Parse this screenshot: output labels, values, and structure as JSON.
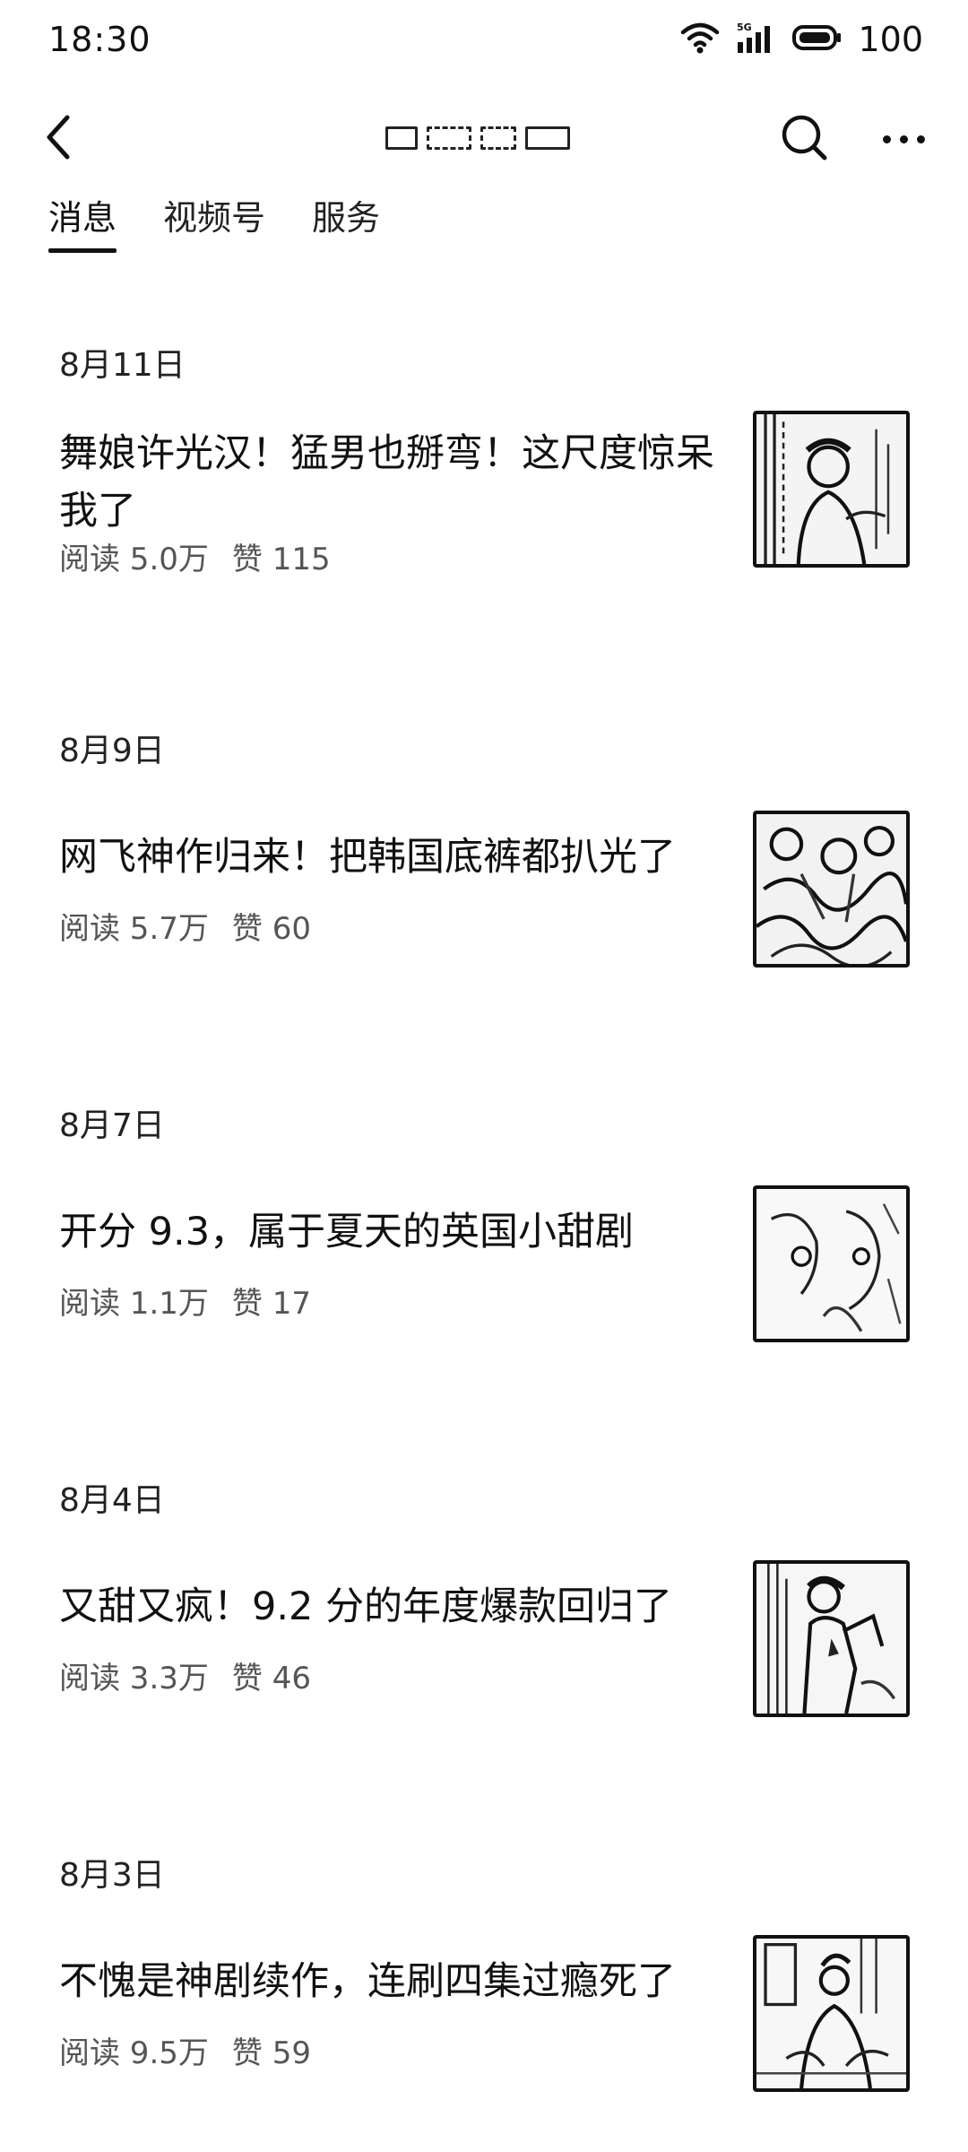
{
  "status_bar": {
    "time": "18:30",
    "network": "5G",
    "battery": "100",
    "icons": [
      "wifi-icon",
      "signal-5g-icon",
      "battery-icon"
    ]
  },
  "header": {
    "back_icon": "chevron-left-icon",
    "search_icon": "search-icon",
    "more_icon": "more-dots-icon"
  },
  "tabs": [
    {
      "label": "消息",
      "active": true
    },
    {
      "label": "视频号",
      "active": false
    },
    {
      "label": "服务",
      "active": false
    }
  ],
  "articles": [
    {
      "date": "8月11日",
      "title": "舞娘许光汉！猛男也掰弯！这尺度惊呆我了",
      "reads": "阅读 5.0万",
      "likes": "赞 115"
    },
    {
      "date": "8月9日",
      "title": "网飞神作归来！把韩国底裤都扒光了",
      "reads": "阅读 5.7万",
      "likes": "赞 60"
    },
    {
      "date": "8月7日",
      "title": "开分 9.3，属于夏天的英国小甜剧",
      "reads": "阅读 1.1万",
      "likes": "赞 17"
    },
    {
      "date": "8月4日",
      "title": "又甜又疯！9.2 分的年度爆款回归了",
      "reads": "阅读 3.3万",
      "likes": "赞 46"
    },
    {
      "date": "8月3日",
      "title": "不愧是神剧续作，连刷四集过瘾死了",
      "reads": "阅读 9.5万",
      "likes": "赞 59"
    }
  ]
}
